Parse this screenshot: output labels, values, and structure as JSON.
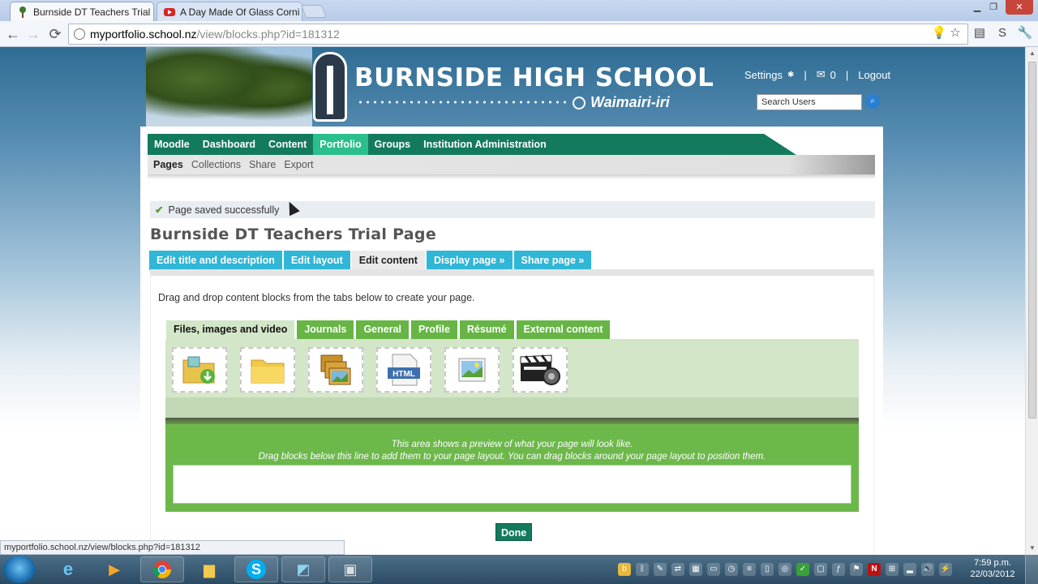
{
  "browser": {
    "tabs": [
      {
        "title": "Burnside DT Teachers Trial",
        "close": "×",
        "active": true
      },
      {
        "title": "A Day Made Of Glass Corni",
        "close": "×",
        "active": false
      }
    ],
    "address": {
      "host": "myportfolio.school.nz",
      "path": "/view/blocks.php?id=181312"
    },
    "nav": {
      "back": "←",
      "forward": "→",
      "reload": "⟳"
    },
    "window_controls": {
      "minimize": "▁",
      "restore": "❐",
      "close": "✕"
    },
    "status_url": "myportfolio.school.nz/view/blocks.php?id=181312"
  },
  "site": {
    "school_name": "BURNSIDE HIGH SCHOOL",
    "school_subtitle": "Waimairi-iri",
    "user_links": {
      "settings": "Settings",
      "messages": "0",
      "logout": "Logout",
      "sep": "|"
    },
    "search": {
      "placeholder": "Search Users",
      "button_icon": "search-icon"
    },
    "main_nav": [
      "Moodle",
      "Dashboard",
      "Content",
      "Portfolio",
      "Groups",
      "Institution Administration"
    ],
    "main_nav_active": "Portfolio",
    "sub_nav": [
      "Pages",
      "Collections",
      "Share",
      "Export"
    ],
    "sub_nav_active": "Pages"
  },
  "page": {
    "flash_message": "Page saved successfully",
    "title": "Burnside DT Teachers Trial Page",
    "edit_tabs": [
      "Edit title and description",
      "Edit layout",
      "Edit content",
      "Display page »",
      "Share page »"
    ],
    "edit_tab_active": "Edit content",
    "instructions": "Drag and drop content blocks from the tabs below to create your page.",
    "category_tabs": [
      "Files, images and video",
      "Journals",
      "General",
      "Profile",
      "Résumé",
      "External content"
    ],
    "category_tab_active": "Files, images and video",
    "blocks": [
      "file-download-icon",
      "folder-icon",
      "image-gallery-icon",
      "html-icon",
      "image-icon",
      "video-icon"
    ],
    "html_block_label": "HTML",
    "preview_line1": "This area shows a preview of what your page will look like.",
    "preview_line2": "Drag blocks below this line to add them to your page layout. You can drag blocks around your page layout to position them.",
    "done_label": "Done"
  },
  "taskbar": {
    "clock_time": "7:59 p.m.",
    "clock_date": "22/03/2012"
  },
  "colors": {
    "nav_green": "#137a5e",
    "nav_active": "#2bbf8e",
    "edit_tab_blue": "#30b6d7",
    "category_green": "#66b545"
  }
}
